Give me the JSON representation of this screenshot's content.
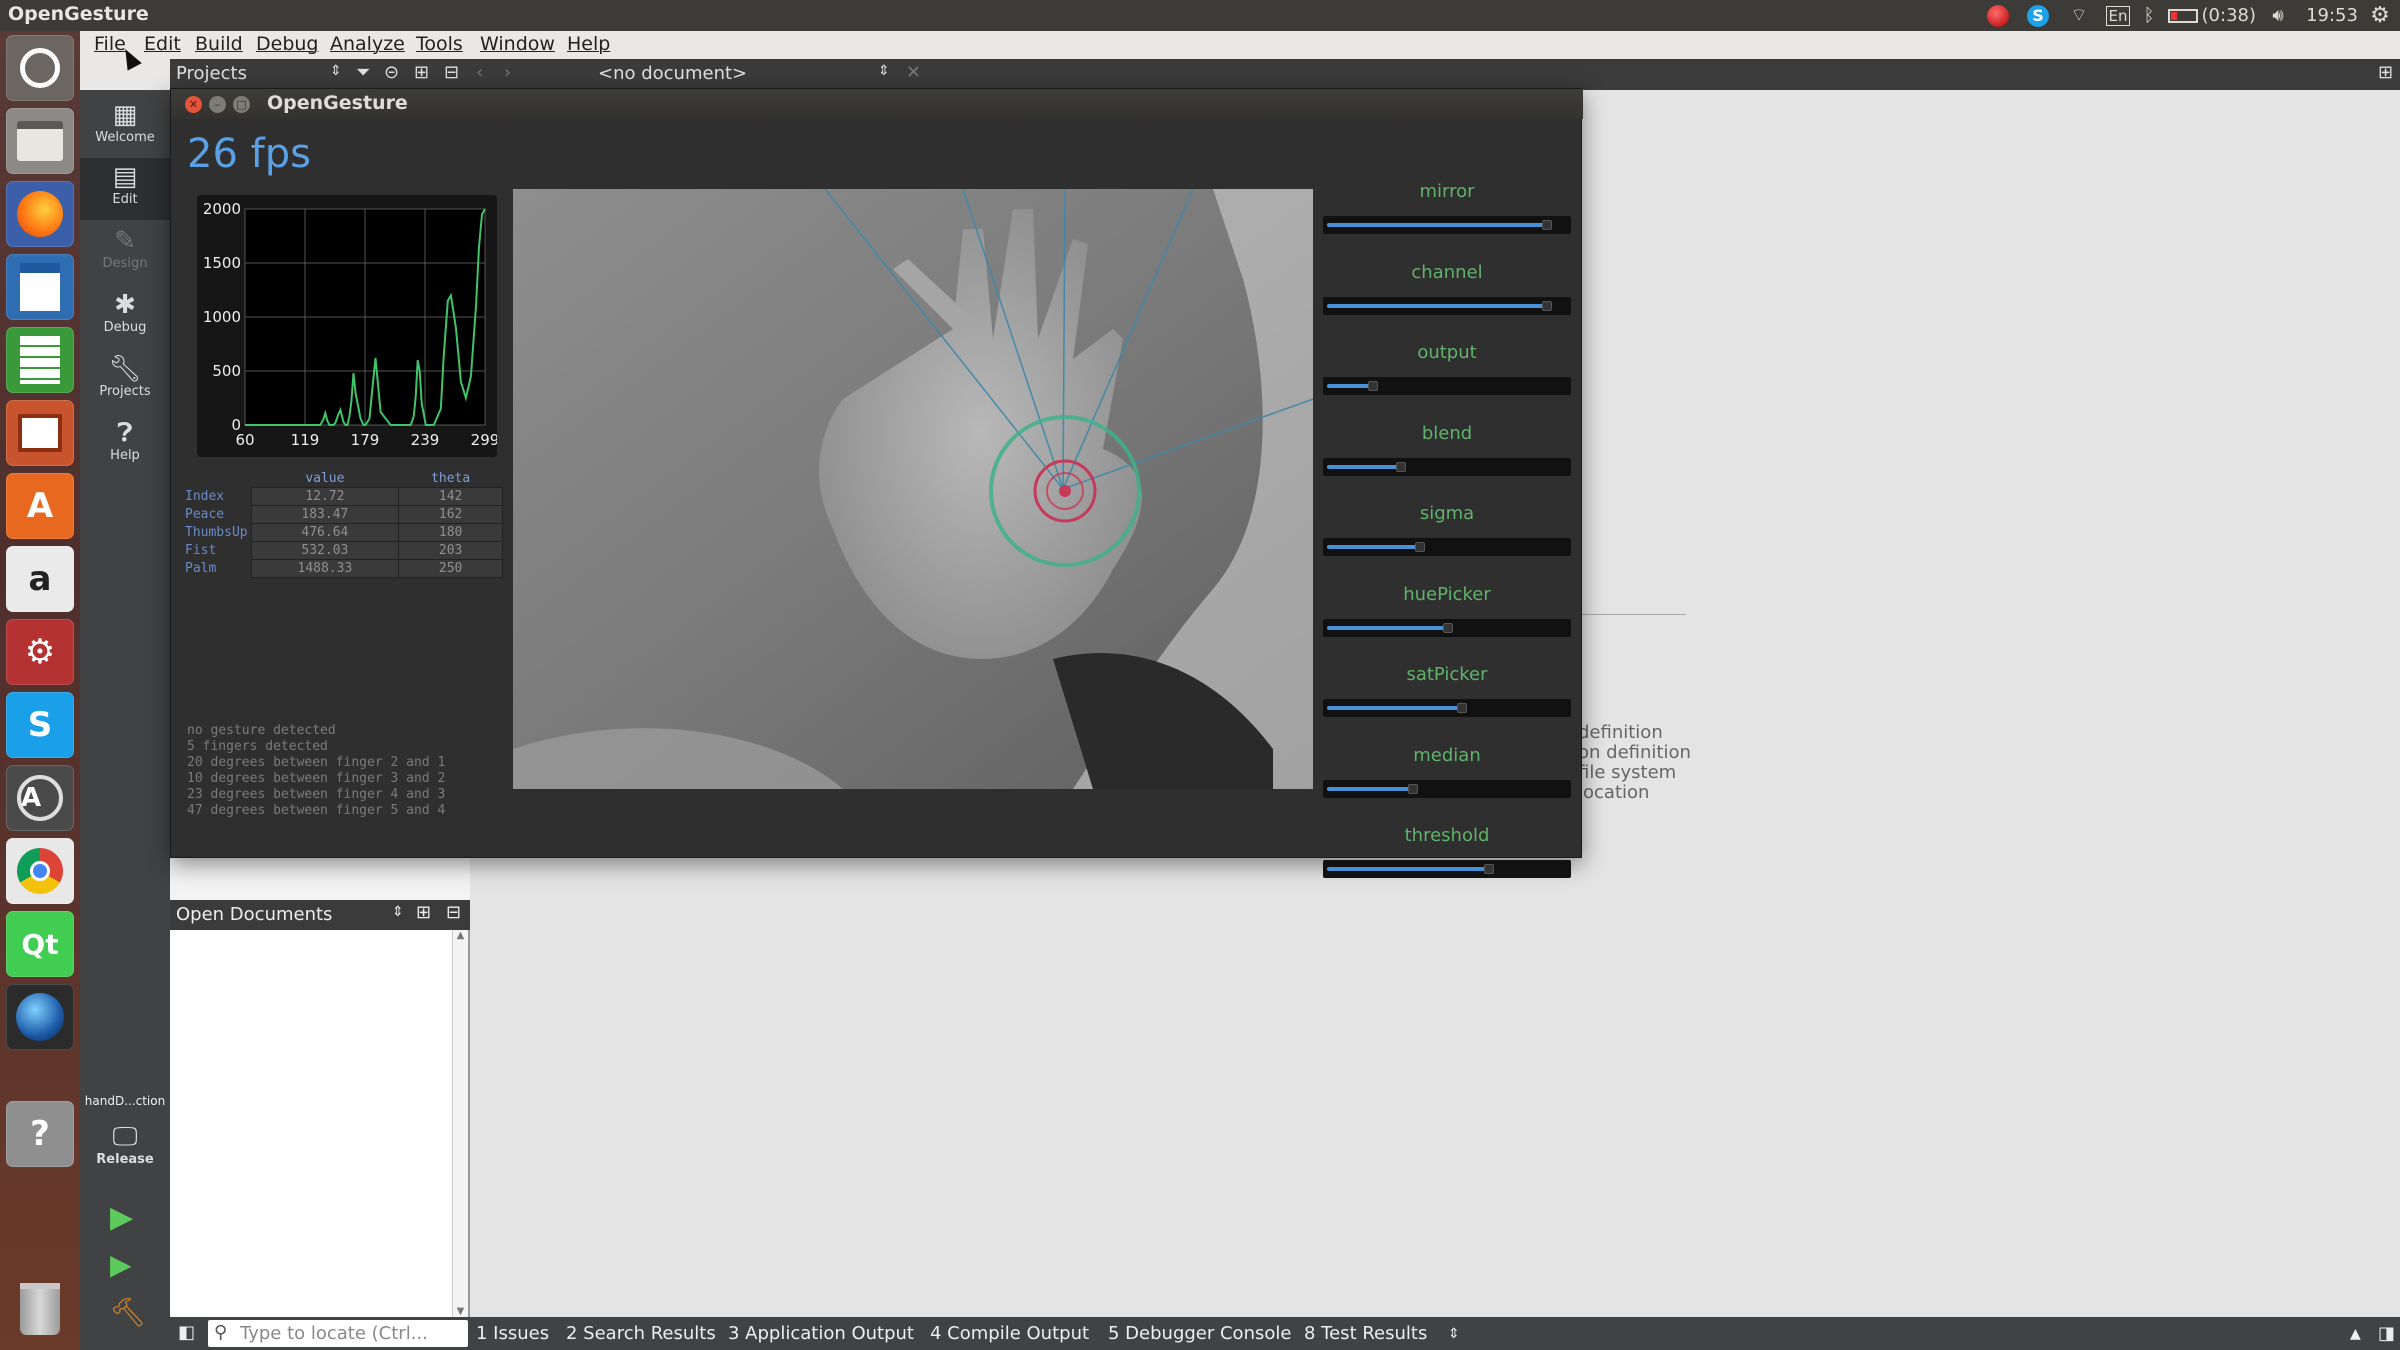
{
  "top_panel": {
    "app_name": "OpenGesture",
    "indicators": {
      "battery": "(0:38)",
      "clock": "19:53",
      "keyboard": "En"
    }
  },
  "menubar": [
    "File",
    "Edit",
    "Build",
    "Debug",
    "Analyze",
    "Tools",
    "Window",
    "Help"
  ],
  "toolbar": {
    "projects_label": "Projects",
    "document_label": "<no document>"
  },
  "modes": [
    {
      "name": "welcome",
      "label": "Welcome"
    },
    {
      "name": "edit",
      "label": "Edit"
    },
    {
      "name": "design",
      "label": "Design"
    },
    {
      "name": "debug",
      "label": "Debug"
    },
    {
      "name": "projects",
      "label": "Projects"
    },
    {
      "name": "help",
      "label": "Help"
    }
  ],
  "kit": {
    "project": "handD...ction",
    "config": "Release"
  },
  "open_documents": {
    "title": "Open Documents"
  },
  "editor_bg_lines": [
    "definition",
    "on definition",
    "file system",
    "location"
  ],
  "bottom": {
    "locate_placeholder": "Type to locate (Ctrl...",
    "tabs": [
      "1  Issues",
      "2  Search Results",
      "3  Application Output",
      "4  Compile Output",
      "5  Debugger Console",
      "8  Test Results"
    ]
  },
  "window": {
    "title": "OpenGesture",
    "fps": "26 fps",
    "table": {
      "headers": [
        "value",
        "theta"
      ],
      "rows": [
        {
          "name": "Index",
          "value": "12.72",
          "theta": "142"
        },
        {
          "name": "Peace",
          "value": "183.47",
          "theta": "162"
        },
        {
          "name": "ThumbsUp",
          "value": "476.64",
          "theta": "180"
        },
        {
          "name": "Fist",
          "value": "532.03",
          "theta": "203"
        },
        {
          "name": "Palm",
          "value": "1488.33",
          "theta": "250"
        }
      ]
    },
    "log": [
      "no gesture detected",
      "5 fingers detected",
      "20 degrees between finger 2 and 1",
      "10 degrees between finger 3 and 2",
      "23 degrees between finger 4 and 3",
      "47 degrees between finger 5 and 4"
    ],
    "sliders": [
      {
        "label": "mirror",
        "value": 0.95
      },
      {
        "label": "channel",
        "value": 0.95
      },
      {
        "label": "output",
        "value": 0.2
      },
      {
        "label": "blend",
        "value": 0.32
      },
      {
        "label": "sigma",
        "value": 0.4
      },
      {
        "label": "huePicker",
        "value": 0.52
      },
      {
        "label": "satPicker",
        "value": 0.58
      },
      {
        "label": "median",
        "value": 0.37
      },
      {
        "label": "threshold",
        "value": 0.7
      }
    ],
    "colors": {
      "accent": "#5aa0e6",
      "slider_label": "#5fb36a",
      "curve": "#3fc46a"
    }
  },
  "chart_data": {
    "type": "line",
    "title": "",
    "xlabel": "",
    "ylabel": "",
    "xlim": [
      60,
      299
    ],
    "ylim": [
      0,
      2000
    ],
    "x_ticks": [
      "60",
      "119",
      "179",
      "239",
      "299"
    ],
    "y_ticks": [
      "2000",
      "1500",
      "1000",
      "500",
      "0"
    ],
    "grid": true,
    "series": [
      {
        "x": [
          60,
          130,
          135,
          138,
          140,
          142,
          144,
          148,
          150,
          153,
          155,
          158,
          160,
          162,
          164,
          166,
          168,
          170,
          175,
          178,
          180,
          184,
          187,
          190,
          195,
          205,
          215,
          220,
          225,
          228,
          230,
          232,
          234,
          236,
          240,
          243,
          248,
          255,
          258,
          262,
          265,
          270,
          275,
          280,
          285,
          290,
          293,
          296,
          299
        ],
        "y": [
          0,
          0,
          0,
          50,
          110,
          40,
          0,
          0,
          20,
          100,
          140,
          30,
          0,
          0,
          80,
          220,
          480,
          300,
          60,
          0,
          0,
          60,
          350,
          620,
          120,
          0,
          0,
          0,
          0,
          80,
          260,
          600,
          500,
          200,
          0,
          0,
          0,
          150,
          650,
          1150,
          1200,
          900,
          400,
          250,
          450,
          1100,
          1650,
          1950,
          2000
        ]
      }
    ]
  }
}
